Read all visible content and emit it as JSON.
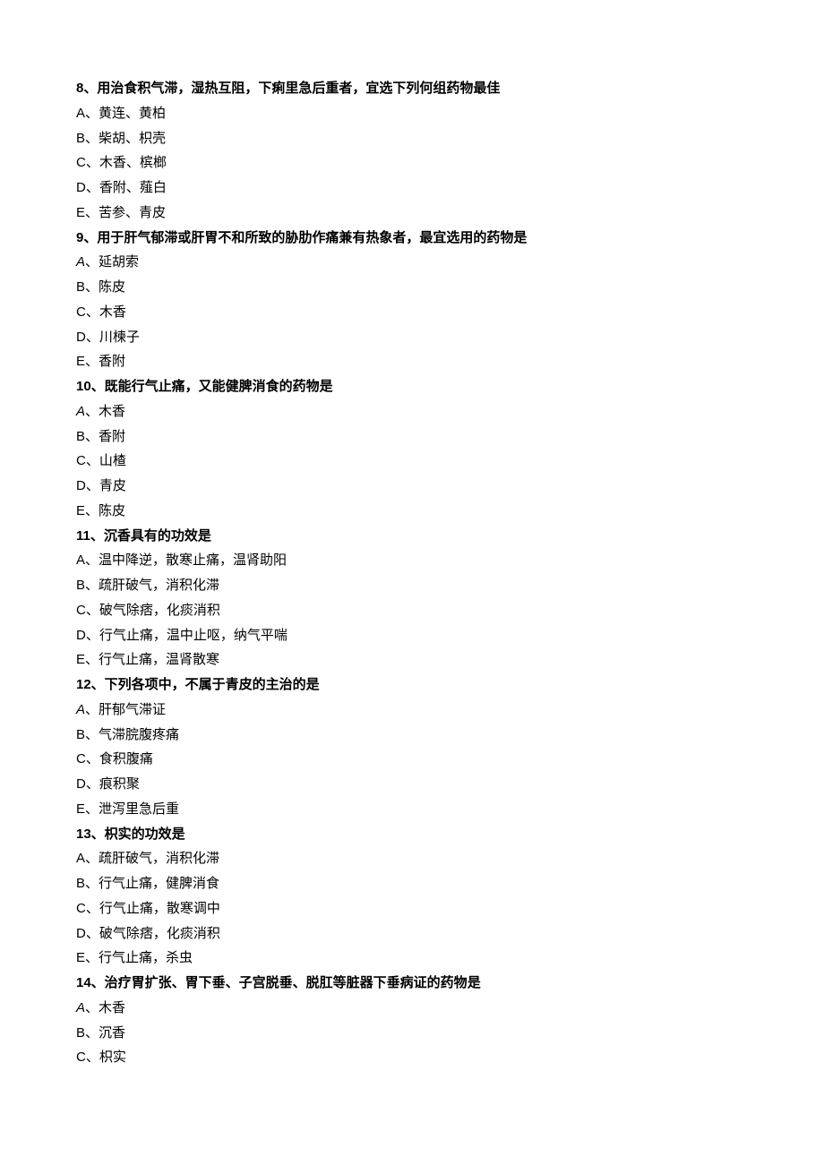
{
  "questions": [
    {
      "number": "8",
      "stem": "用治食积气滞，湿热互阻，下痢里急后重者，宜选下列何组药物最佳",
      "options": [
        {
          "letter": "A",
          "text": "黄连、黄柏",
          "italic": false
        },
        {
          "letter": "B",
          "text": "柴胡、枳壳",
          "italic": false
        },
        {
          "letter": "C",
          "text": "木香、槟榔",
          "italic": false
        },
        {
          "letter": "D",
          "text": "香附、薤白",
          "italic": false
        },
        {
          "letter": "E",
          "text": "苦参、青皮",
          "italic": false
        }
      ]
    },
    {
      "number": "9",
      "stem": "用于肝气郁滞或肝胃不和所致的胁肋作痛兼有热象者，最宜选用的药物是",
      "options": [
        {
          "letter": "A",
          "text": "延胡索",
          "italic": true
        },
        {
          "letter": "B",
          "text": "陈皮",
          "italic": false
        },
        {
          "letter": "C",
          "text": "木香",
          "italic": false
        },
        {
          "letter": "D",
          "text": "川楝子",
          "italic": false
        },
        {
          "letter": "E",
          "text": "香附",
          "italic": false
        }
      ]
    },
    {
      "number": "10",
      "stem": "既能行气止痛，又能健脾消食的药物是",
      "options": [
        {
          "letter": "A",
          "text": "木香",
          "italic": true
        },
        {
          "letter": "B",
          "text": "香附",
          "italic": false
        },
        {
          "letter": "C",
          "text": "山楂",
          "italic": false
        },
        {
          "letter": "D",
          "text": "青皮",
          "italic": false
        },
        {
          "letter": "E",
          "text": "陈皮",
          "italic": false
        }
      ]
    },
    {
      "number": "11",
      "stem": "沉香具有的功效是",
      "options": [
        {
          "letter": "A",
          "text": "温中降逆，散寒止痛，温肾助阳",
          "italic": false
        },
        {
          "letter": "B",
          "text": "疏肝破气，消积化滞",
          "italic": false
        },
        {
          "letter": "C",
          "text": "破气除痞，化痰消积",
          "italic": false
        },
        {
          "letter": "D",
          "text": "行气止痛，温中止呕，纳气平喘",
          "italic": false
        },
        {
          "letter": "E",
          "text": "行气止痛，温肾散寒",
          "italic": false
        }
      ]
    },
    {
      "number": "12",
      "stem": "下列各项中，不属于青皮的主治的是",
      "options": [
        {
          "letter": "A",
          "text": "肝郁气滞证",
          "italic": true
        },
        {
          "letter": "B",
          "text": "气滞脘腹疼痛",
          "italic": false
        },
        {
          "letter": "C",
          "text": "食积腹痛",
          "italic": false
        },
        {
          "letter": "D",
          "text": "痕积聚",
          "italic": false
        },
        {
          "letter": "E",
          "text": "泄泻里急后重",
          "italic": false
        }
      ]
    },
    {
      "number": "13",
      "stem": "枳实的功效是",
      "options": [
        {
          "letter": "A",
          "text": "疏肝破气，消积化滞",
          "italic": false
        },
        {
          "letter": "B",
          "text": "行气止痛，健脾消食",
          "italic": false
        },
        {
          "letter": "C",
          "text": "行气止痛，散寒调中",
          "italic": false
        },
        {
          "letter": "D",
          "text": "破气除痞，化痰消积",
          "italic": false
        },
        {
          "letter": "E",
          "text": "行气止痛，杀虫",
          "italic": false
        }
      ]
    },
    {
      "number": "14",
      "stem": "治疗胃扩张、胃下垂、子宫脱垂、脱肛等脏器下垂病证的药物是",
      "options": [
        {
          "letter": "A",
          "text": "木香",
          "italic": true
        },
        {
          "letter": "B",
          "text": "沉香",
          "italic": false
        },
        {
          "letter": "C",
          "text": "枳实",
          "italic": false
        }
      ]
    }
  ],
  "separator": "、"
}
